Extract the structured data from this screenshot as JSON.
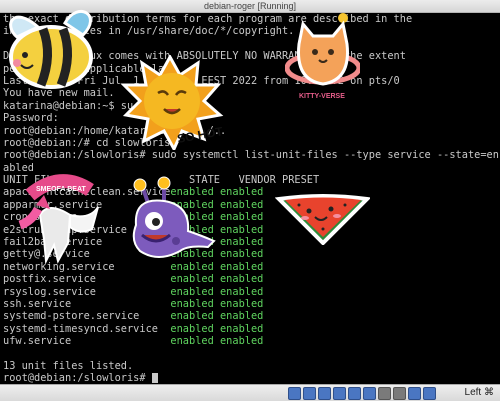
{
  "window": {
    "title": "debian-roger [Running]"
  },
  "terminal_lines": [
    {
      "text": "the exact distribution terms for each program are described in the",
      "bright": false
    },
    {
      "text": "individual files in /usr/share/doc/*/copyright.",
      "bright": false
    },
    {
      "text": "",
      "bright": false
    },
    {
      "text": "Debian GNU/Linux comes with ABSOLUTELY NO WARRANTY, to the extent",
      "bright": false
    },
    {
      "text": "permitted by applicable law.",
      "bright": false
    },
    {
      "text": "Last login: Fri Jul  1 11:42:37 EEST 2022 from 10.0.2.2 on pts/0",
      "bright": false
    },
    {
      "text": "You have new mail.",
      "bright": false
    },
    {
      "text": "katarina@debian:~$ su",
      "bright": false
    },
    {
      "text": "Password:",
      "bright": false
    },
    {
      "text": "root@debian:/home/katarina# cd ../..",
      "bright": false
    },
    {
      "text": "root@debian:/# cd slowloris",
      "bright": false
    },
    {
      "text": "root@debian:/slowloris# sudo systemctl list-unit-files --type service --state=en",
      "bright": false
    },
    {
      "text": "abled",
      "bright": false
    }
  ],
  "table": {
    "header": {
      "unit": "UNIT FILE",
      "state": "STATE",
      "preset": "VENDOR PRESET"
    },
    "rows": [
      {
        "unit": "apache-htcacheclean.service",
        "state": "enabled",
        "preset": "enabled"
      },
      {
        "unit": "apparmor.service",
        "state": "enabled",
        "preset": "enabled"
      },
      {
        "unit": "cron.service",
        "state": "enabled",
        "preset": "enabled"
      },
      {
        "unit": "e2scrub_reap.service",
        "state": "enabled",
        "preset": "enabled"
      },
      {
        "unit": "fail2ban.service",
        "state": "enabled",
        "preset": "enabled"
      },
      {
        "unit": "getty@.service",
        "state": "enabled",
        "preset": "enabled"
      },
      {
        "unit": "networking.service",
        "state": "enabled",
        "preset": "enabled"
      },
      {
        "unit": "postfix.service",
        "state": "enabled",
        "preset": "enabled"
      },
      {
        "unit": "rsyslog.service",
        "state": "enabled",
        "preset": "enabled"
      },
      {
        "unit": "ssh.service",
        "state": "enabled",
        "preset": "enabled"
      },
      {
        "unit": "systemd-pstore.service",
        "state": "enabled",
        "preset": "enabled"
      },
      {
        "unit": "systemd-timesyncd.service",
        "state": "enabled",
        "preset": "enabled"
      },
      {
        "unit": "ufw.service",
        "state": "enabled",
        "preset": "enabled"
      }
    ]
  },
  "footer_lines": [
    "",
    "13 unit files listed.",
    "root@debian:/slowloris# "
  ],
  "statusbar": {
    "host_key_label": "Left ⌘"
  },
  "stickers": {
    "sun_text": "SO HOT",
    "cat_text": "KITTY-VERSE",
    "unicorn_text": "SMEOFA BEAT"
  },
  "colors": {
    "enabled_text": "#5fd35f",
    "terminal_bg": "#000000",
    "terminal_text": "#c9c9c9"
  },
  "icons": [
    "bee-sticker",
    "sun-sticker",
    "cat-planet-sticker",
    "unicorn-sticker",
    "purple-monster-sticker",
    "watermelon-sticker"
  ]
}
